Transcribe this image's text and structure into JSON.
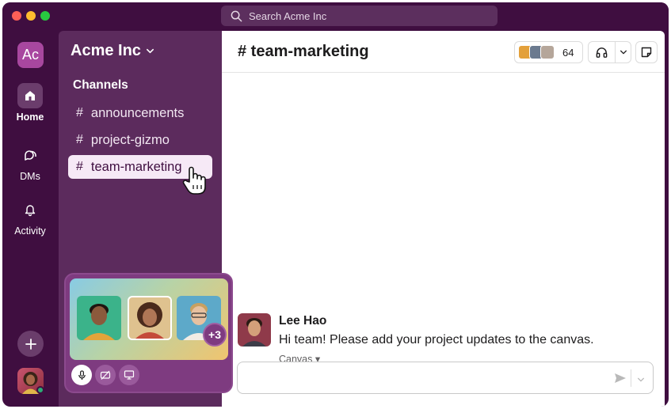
{
  "titlebar": {
    "search_placeholder": "Search Acme Inc"
  },
  "rail": {
    "workspace_initials": "Ac",
    "items": [
      {
        "label": "Home",
        "icon": "home-icon",
        "active": true
      },
      {
        "label": "DMs",
        "icon": "dms-icon",
        "active": false
      },
      {
        "label": "Activity",
        "icon": "bell-icon",
        "active": false
      }
    ]
  },
  "sidebar": {
    "workspace_name": "Acme Inc",
    "section_title": "Channels",
    "channels": [
      {
        "hash": "#",
        "name": "announcements"
      },
      {
        "hash": "#",
        "name": "project-gizmo"
      },
      {
        "hash": "#",
        "name": "team-marketing",
        "active": true
      }
    ]
  },
  "huddle": {
    "extra_count": "+3"
  },
  "main": {
    "channel_title": "# team-marketing",
    "member_count": "64",
    "message": {
      "author": "Lee Hao",
      "text": "Hi team! Please add your project updates to the canvas.",
      "attachment_label": "Canvas ▾"
    }
  },
  "colors": {
    "aubergine": "#3f0e40",
    "sidebar": "#5c2b5d",
    "active_channel_bg": "#f6e9f6",
    "presence_green": "#2bac76"
  }
}
